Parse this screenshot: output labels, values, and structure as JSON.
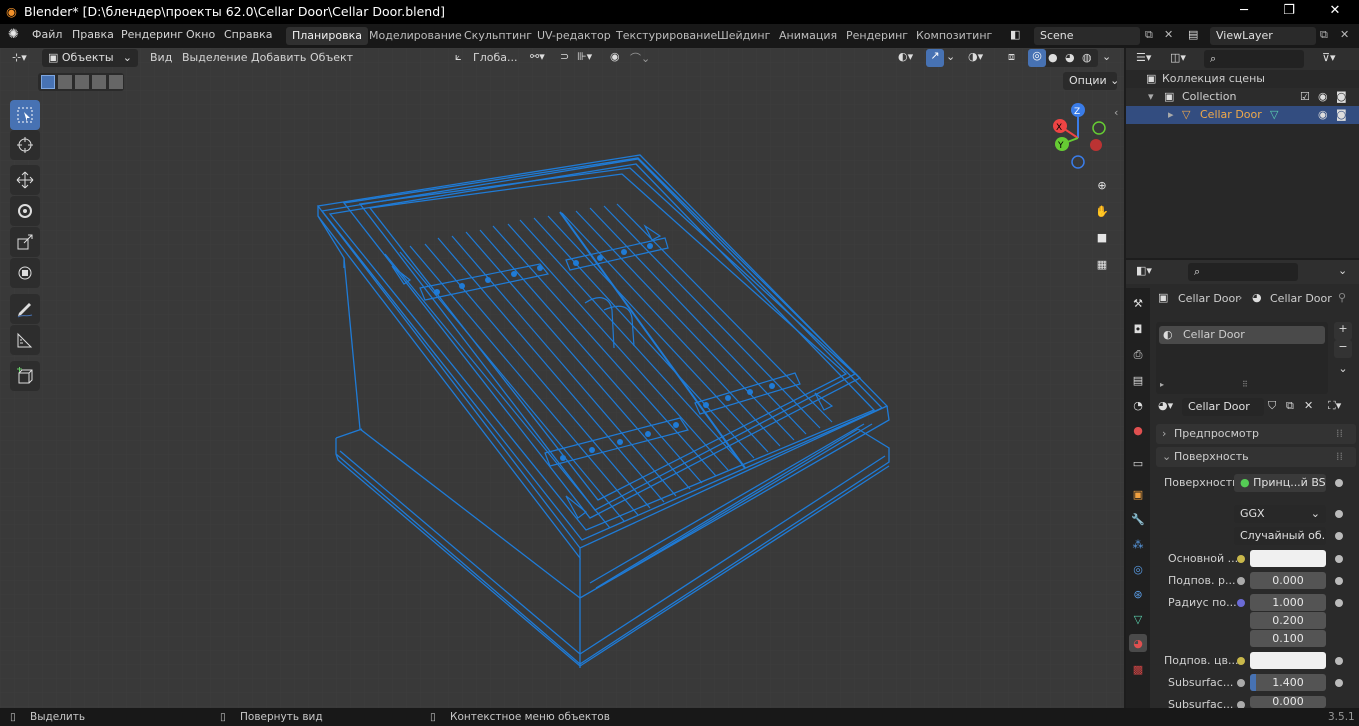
{
  "title_bar": {
    "title": "Blender* [D:\\блендер\\проекты 62.0\\Cellar Door\\Cellar Door.blend]",
    "minimize": "─",
    "maximize": "❐",
    "close": "✕"
  },
  "menu": {
    "items": [
      "Файл",
      "Правка",
      "Рендеринг",
      "Окно",
      "Справка"
    ]
  },
  "workspaces": {
    "tabs": [
      "Планировка",
      "Моделирование",
      "Скульптинг",
      "UV-редактор",
      "Текстурирование",
      "Шейдинг",
      "Анимация",
      "Рендеринг",
      "Композитинг"
    ],
    "active": "Планировка"
  },
  "scene": {
    "name": "Scene",
    "view_layer": "ViewLayer"
  },
  "viewport": {
    "mode": "Объекты",
    "menus": [
      "Вид",
      "Выделение",
      "Добавить",
      "Объект"
    ],
    "orientation": "Глоба...",
    "options": "Опции",
    "gizmo_labels": {
      "x": "X",
      "y": "Y",
      "z": "Z"
    }
  },
  "outliner": {
    "root": "Коллекция сцены",
    "collection": "Collection",
    "object": "Cellar Door"
  },
  "properties": {
    "breadcrumb": {
      "object": "Cellar Door",
      "material": "Cellar Door"
    },
    "slot": "Cellar Door",
    "material_name": "Cellar Door",
    "panels": {
      "preview": "Предпросмотр",
      "surface": "Поверхность"
    },
    "surface": {
      "label": "Поверхность",
      "shader": "Принц...й BSDF",
      "distribution": "GGX",
      "subsurface_method": "Случайный об..."
    },
    "fields": [
      {
        "label": "Основной ...",
        "type": "color",
        "value": ""
      },
      {
        "label": "Подпов. р...",
        "type": "number",
        "value": "0.000"
      },
      {
        "label": "Радиус по...",
        "type": "number",
        "value": "1.000"
      },
      {
        "label": "",
        "type": "number",
        "value": "0.200"
      },
      {
        "label": "",
        "type": "number",
        "value": "0.100"
      },
      {
        "label": "Подпов. цв...",
        "type": "color",
        "value": ""
      },
      {
        "label": "Subsurfac...",
        "type": "number",
        "value": "1.400"
      },
      {
        "label": "Subsurfac...",
        "type": "number",
        "value": "0.000"
      }
    ]
  },
  "status_bar": {
    "select": "Выделить",
    "rotate": "Повернуть вид",
    "context": "Контекстное меню объектов",
    "version": "3.5.1"
  },
  "colors": {
    "wire": "#1f7bd6",
    "accent": "#4772b3",
    "active_tab": "#e64a3a",
    "selected_row": "#334d80",
    "object_text": "#f0a94a"
  }
}
